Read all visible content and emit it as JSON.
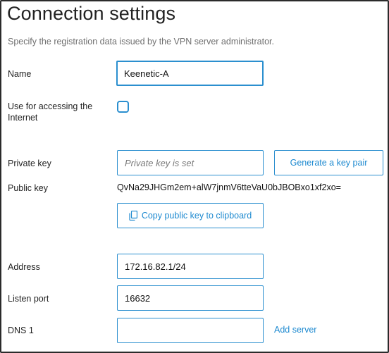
{
  "page": {
    "title": "Connection settings",
    "subtitle": "Specify the registration data issued by the VPN server administrator."
  },
  "form": {
    "name": {
      "label": "Name",
      "value": "Keenetic-A"
    },
    "internet": {
      "label_line1": "Use for accessing the",
      "label_line2": "Internet",
      "checked": false
    },
    "private_key": {
      "label": "Private key",
      "placeholder": "Private key is set",
      "value": ""
    },
    "generate_button": "Generate a key pair",
    "public_key": {
      "label": "Public key",
      "value": "QvNa29JHGm2em+alW7jnmV6tteVaU0bJBOBxo1xf2xo="
    },
    "copy_button": "Copy public key to clipboard",
    "address": {
      "label": "Address",
      "value": "172.16.82.1/24"
    },
    "listen_port": {
      "label": "Listen port",
      "value": "16632"
    },
    "dns1": {
      "label": "DNS 1",
      "value": ""
    },
    "add_server_link": "Add server"
  },
  "icons": {
    "copy": "copy-icon"
  },
  "colors": {
    "accent": "#2b8fcf",
    "link": "#1e8ad0",
    "subtitle": "#6f6f6f"
  }
}
